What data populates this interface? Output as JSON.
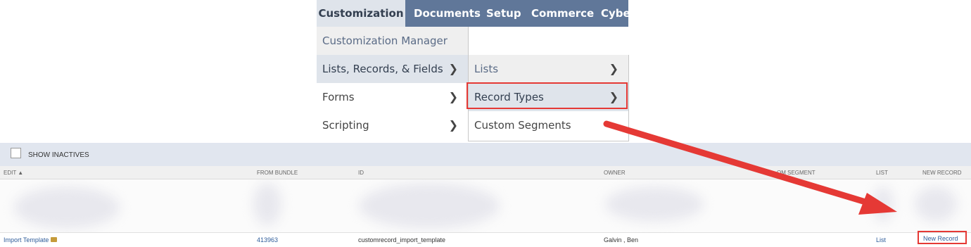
{
  "nav": {
    "tabs": [
      {
        "label": "Customization",
        "active": true
      },
      {
        "label": "Documents"
      },
      {
        "label": "Setup"
      },
      {
        "label": "Commerce"
      },
      {
        "label": "Cyber"
      }
    ]
  },
  "menu_level1": [
    {
      "label": "Customization Manager"
    },
    {
      "label": "Lists, Records, & Fields",
      "has_submenu": true,
      "highlighted": true
    },
    {
      "label": "Forms",
      "has_submenu": true
    },
    {
      "label": "Scripting",
      "has_submenu": true
    }
  ],
  "menu_level2": [
    {
      "label": "Lists",
      "has_submenu": true
    },
    {
      "label": "Record Types",
      "has_submenu": true,
      "highlighted": true
    },
    {
      "label": "Custom Segments"
    }
  ],
  "list": {
    "show_inactives_label": "SHOW INACTIVES",
    "columns": {
      "edit": "EDIT ▲",
      "from_bundle": "FROM BUNDLE",
      "id": "ID",
      "owner": "OWNER",
      "custom_segment": "OM SEGMENT",
      "list": "LIST",
      "new_record": "NEW RECORD"
    },
    "row": {
      "name": "Import Template",
      "from_bundle": "413963",
      "id": "customrecord_import_template",
      "owner": "Galvin , Ben",
      "list": "List",
      "new_record": "New Record"
    }
  },
  "colors": {
    "nav_bg": "#607799",
    "highlight": "#dfe4eb",
    "annotation_red": "#e53935",
    "link": "#2e5c9a"
  }
}
